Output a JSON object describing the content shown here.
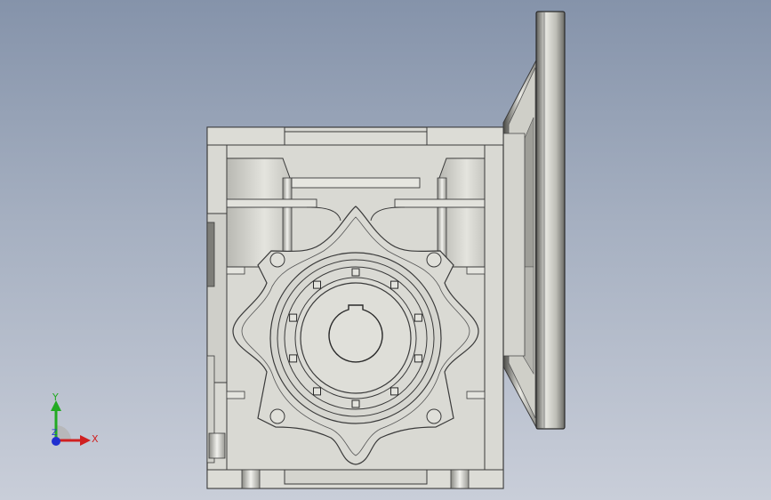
{
  "viewport": {
    "background_top": "#8593aa",
    "background_bottom": "#c9ced9"
  },
  "model": {
    "part_colors": {
      "housing_fill": "#d9d9d3",
      "housing_edge": "#3a3a3a",
      "flange_light": "#e6e6e0",
      "flange_dark": "#5c5c58"
    },
    "bore_markers": 10
  },
  "triad": {
    "x_label": "X",
    "y_label": "Y",
    "z_label": "Z",
    "x_color": "#d02020",
    "y_color": "#22aa22",
    "z_color": "#2030d0"
  }
}
